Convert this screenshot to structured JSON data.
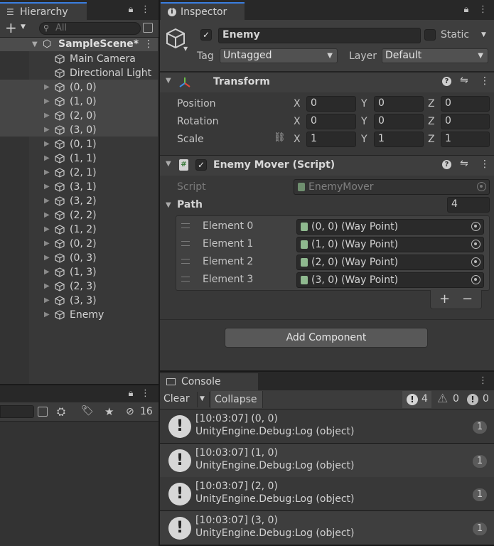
{
  "hierarchy": {
    "tab_label": "Hierarchy",
    "search_placeholder": "All",
    "scene_name": "SampleScene*",
    "items": [
      {
        "label": "Main Camera",
        "has_arrow": false
      },
      {
        "label": "Directional Light",
        "has_arrow": false
      },
      {
        "label": "(0, 0)",
        "has_arrow": true
      },
      {
        "label": "(1, 0)",
        "has_arrow": true
      },
      {
        "label": "(2, 0)",
        "has_arrow": true
      },
      {
        "label": "(3, 0)",
        "has_arrow": true
      },
      {
        "label": "(0, 1)",
        "has_arrow": true
      },
      {
        "label": "(1, 1)",
        "has_arrow": true
      },
      {
        "label": "(2, 1)",
        "has_arrow": true
      },
      {
        "label": "(3, 1)",
        "has_arrow": true
      },
      {
        "label": "(3, 2)",
        "has_arrow": true
      },
      {
        "label": "(2, 2)",
        "has_arrow": true
      },
      {
        "label": "(1, 2)",
        "has_arrow": true
      },
      {
        "label": "(0, 2)",
        "has_arrow": true
      },
      {
        "label": "(0, 3)",
        "has_arrow": true
      },
      {
        "label": "(1, 3)",
        "has_arrow": true
      },
      {
        "label": "(2, 3)",
        "has_arrow": true
      },
      {
        "label": "(3, 3)",
        "has_arrow": true
      },
      {
        "label": "Enemy",
        "has_arrow": true
      }
    ]
  },
  "project_panel": {
    "hidden_count": "16"
  },
  "inspector": {
    "tab_label": "Inspector",
    "object_name": "Enemy",
    "static_label": "Static",
    "tag_label": "Tag",
    "tag_value": "Untagged",
    "layer_label": "Layer",
    "layer_value": "Default",
    "transform": {
      "title": "Transform",
      "rows": [
        {
          "label": "Position",
          "x": "0",
          "y": "0",
          "z": "0"
        },
        {
          "label": "Rotation",
          "x": "0",
          "y": "0",
          "z": "0"
        },
        {
          "label": "Scale",
          "x": "1",
          "y": "1",
          "z": "1"
        }
      ],
      "axis_x": "X",
      "axis_y": "Y",
      "axis_z": "Z"
    },
    "enemy_mover": {
      "title": "Enemy Mover (Script)",
      "script_label": "Script",
      "script_value": "EnemyMover",
      "path_label": "Path",
      "path_size": "4",
      "elements": [
        {
          "label": "Element 0",
          "value": "(0, 0) (Way Point)"
        },
        {
          "label": "Element 1",
          "value": "(1, 0) (Way Point)"
        },
        {
          "label": "Element 2",
          "value": "(2, 0) (Way Point)"
        },
        {
          "label": "Element 3",
          "value": "(3, 0) (Way Point)"
        }
      ],
      "plus": "+",
      "minus": "−"
    },
    "add_component_label": "Add Component"
  },
  "console": {
    "tab_label": "Console",
    "clear_label": "Clear",
    "collapse_label": "Collapse",
    "log_count": "4",
    "warn_count": "0",
    "error_count": "0",
    "entries": [
      {
        "line1": "[10:03:07] (0, 0)",
        "line2": "UnityEngine.Debug:Log (object)",
        "count": "1"
      },
      {
        "line1": "[10:03:07] (1, 0)",
        "line2": "UnityEngine.Debug:Log (object)",
        "count": "1"
      },
      {
        "line1": "[10:03:07] (2, 0)",
        "line2": "UnityEngine.Debug:Log (object)",
        "count": "1"
      },
      {
        "line1": "[10:03:07] (3, 0)",
        "line2": "UnityEngine.Debug:Log (object)",
        "count": "1"
      }
    ]
  }
}
